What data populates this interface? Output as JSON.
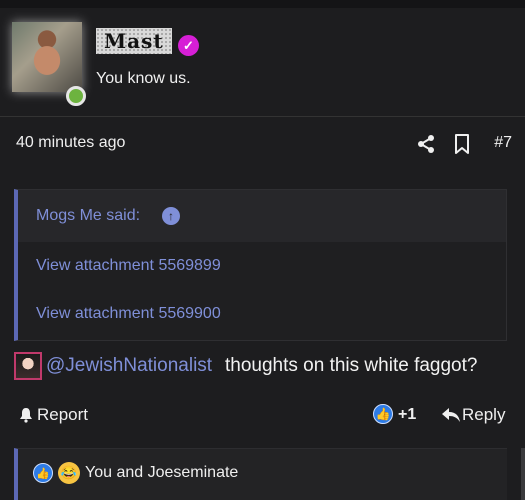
{
  "author": {
    "username": "Mast",
    "tagline": "You know us.",
    "verified_icon": "verified-badge-icon",
    "status": "online"
  },
  "meta": {
    "timestamp": "40 minutes ago",
    "post_number": "#7"
  },
  "quote": {
    "author_label": "Mogs Me said:",
    "attachments": [
      "View attachment 5569899",
      "View attachment 5569900"
    ]
  },
  "message": {
    "mention": "@JewishNationalist",
    "text": "thoughts on this white faggot?"
  },
  "actions": {
    "report": "Report",
    "reaction_count": "+1",
    "reply": "Reply"
  },
  "reactions": {
    "summary": "You and Joeseminate"
  },
  "colors": {
    "background": "#1d1d1f",
    "accent": "#7f8fd8",
    "quote_bar": "#5c68b5",
    "verified": "#d61fd6",
    "online": "#6db33f"
  }
}
